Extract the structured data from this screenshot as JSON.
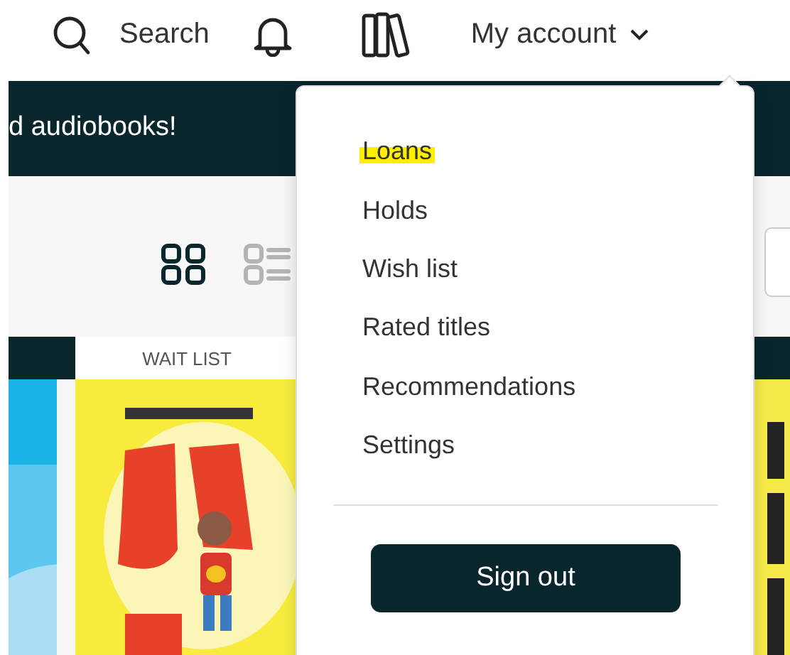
{
  "header": {
    "search_label": "Search",
    "account_label": "My account"
  },
  "banner": {
    "text": "d audiobooks!"
  },
  "view_toggles": [
    {
      "kind": "grid",
      "selected": true
    },
    {
      "kind": "list",
      "selected": false
    }
  ],
  "books": [
    {
      "kind": "picture"
    },
    {
      "kind": "picture",
      "status": "WAIT LIST"
    },
    {
      "kind": "picture"
    }
  ],
  "account_menu": {
    "items": [
      {
        "label": "Loans",
        "highlighted": true
      },
      {
        "label": "Holds",
        "highlighted": false
      },
      {
        "label": "Wish list",
        "highlighted": false
      },
      {
        "label": "Rated titles",
        "highlighted": false
      },
      {
        "label": "Recommendations",
        "highlighted": false
      },
      {
        "label": "Settings",
        "highlighted": false
      }
    ],
    "sign_out": "Sign out"
  }
}
